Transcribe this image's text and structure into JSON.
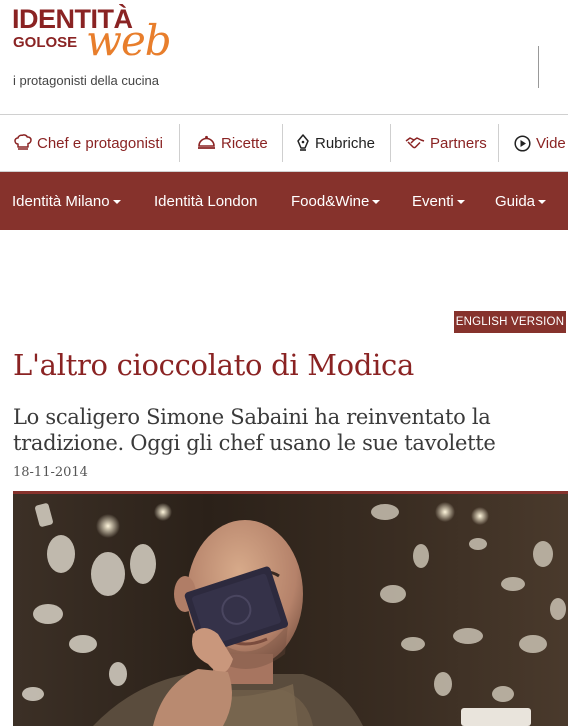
{
  "logo": {
    "word1": "IDENTITÀ",
    "word2": "GOLOSE",
    "word3": "web",
    "tagline": "i protagonisti della cucina"
  },
  "subnav": {
    "items": [
      {
        "label": "Chef e protagonisti",
        "icon": "chef-hat-icon"
      },
      {
        "label": "Ricette",
        "icon": "cloche-icon"
      },
      {
        "label": "Rubriche",
        "icon": "pen-nib-icon"
      },
      {
        "label": "Partners",
        "icon": "handshake-icon"
      },
      {
        "label": "Vide",
        "icon": "play-icon"
      }
    ]
  },
  "mainnav": {
    "items": [
      {
        "label": "Identità Milano",
        "dropdown": true
      },
      {
        "label": "Identità London",
        "dropdown": false
      },
      {
        "label": "Food&Wine",
        "dropdown": true
      },
      {
        "label": "Eventi",
        "dropdown": true
      },
      {
        "label": "Guida",
        "dropdown": true
      }
    ]
  },
  "article": {
    "english_label": "ENGLISH VERSION",
    "title": "L'altro cioccolato di Modica",
    "subtitle": "Lo scaligero Simone Sabaini ha reinventato la tradizione. Oggi gli chef usano le sue tavolette",
    "date": "18-11-2014"
  },
  "colors": {
    "brand_red": "#86322c",
    "logo_orange": "#e87e2c"
  }
}
